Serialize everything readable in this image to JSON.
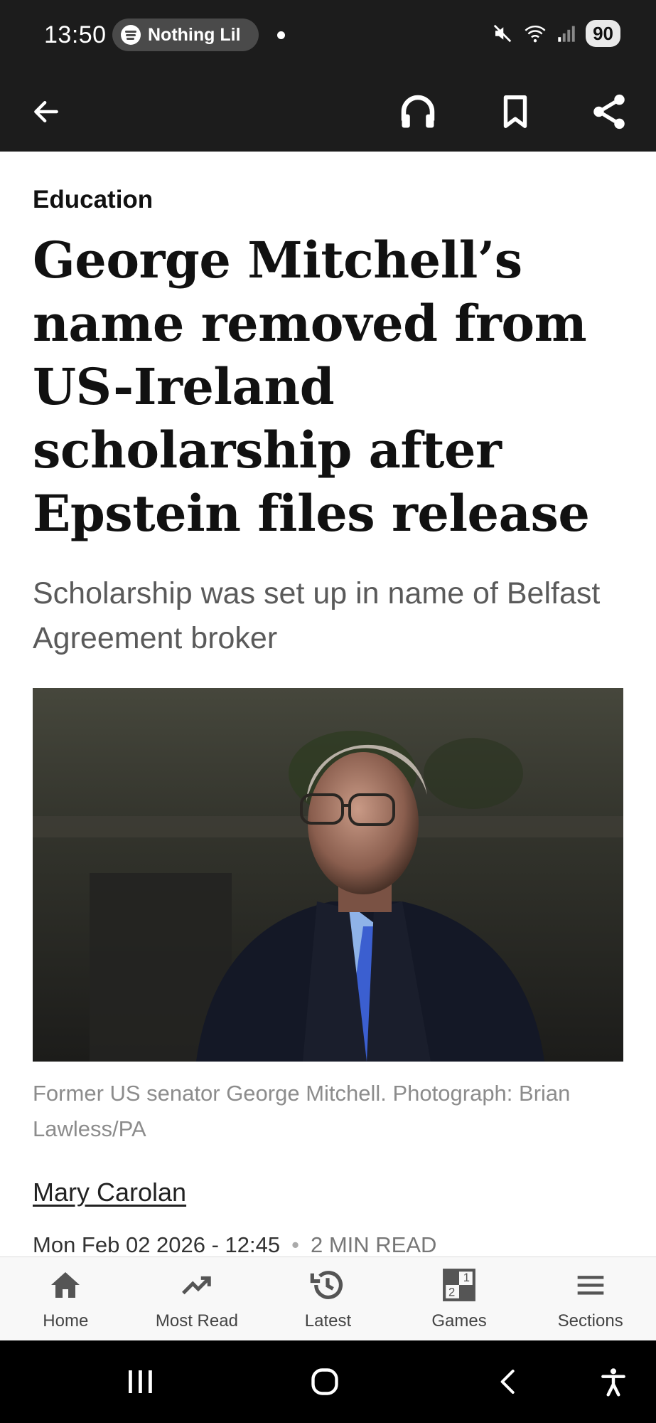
{
  "status_bar": {
    "time": "13:50",
    "media_label": "Nothing Lil",
    "battery": "90"
  },
  "app_bar": {
    "icons": [
      "back-arrow-icon",
      "headphones-icon",
      "bookmark-icon",
      "share-icon"
    ]
  },
  "article": {
    "section": "Education",
    "headline": "George Mitchell’s name removed from US-Ireland scholarship after Epstein files release",
    "standfirst": "Scholarship was set up in name of Belfast Agreement broker",
    "caption": "Former US senator George Mitchell. Photograph: Brian Lawless/PA",
    "author": "Mary Carolan",
    "date": "Mon Feb 02 2026 - 12:45",
    "separator": "•",
    "read_time": "2 MIN READ"
  },
  "bottom_nav": {
    "items": [
      {
        "label": "Home",
        "icon": "home-icon"
      },
      {
        "label": "Most Read",
        "icon": "trending-icon"
      },
      {
        "label": "Latest",
        "icon": "history-icon"
      },
      {
        "label": "Games",
        "icon": "games-icon",
        "badge_top": "1",
        "badge_bottom": "2"
      },
      {
        "label": "Sections",
        "icon": "menu-icon"
      }
    ]
  },
  "colors": {
    "top_bar": "#1c1c1c",
    "headline": "#111111",
    "standfirst": "#5a5a5a",
    "caption": "#8c8c8c",
    "nav_background": "#f8f8f8"
  }
}
